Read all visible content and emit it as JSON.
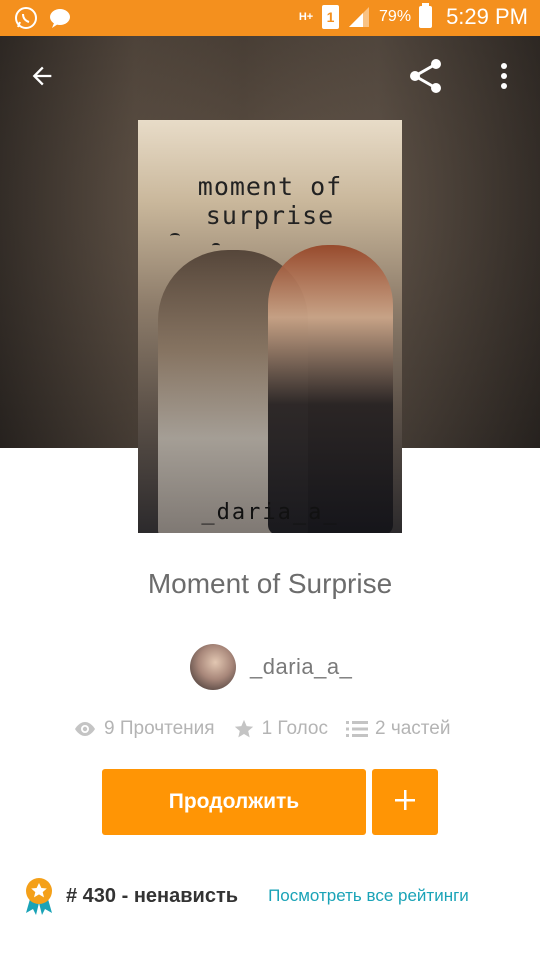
{
  "status_bar": {
    "battery_percent": "79%",
    "time": "5:29 PM",
    "network_type": "H+",
    "sim_slot": "1",
    "icons": [
      "whatsapp-icon",
      "message-icon",
      "signal-icon",
      "battery-icon"
    ]
  },
  "toolbar": {
    "icons": [
      "back-arrow-icon",
      "share-icon",
      "more-vert-icon"
    ]
  },
  "cover": {
    "title": "moment of surprise",
    "author": "_daria_a_"
  },
  "story": {
    "title": "Moment of Surprise",
    "author": "_daria_a_"
  },
  "stats": {
    "reads": "9 Прочтения",
    "votes": "1 Голос",
    "parts": "2 частей"
  },
  "actions": {
    "continue_label": "Продолжить",
    "add_label": "+"
  },
  "ranking": {
    "rank": "# 430",
    "separator": " - ",
    "tag": "ненависть",
    "view_all_label": "Посмотреть все рейтинги"
  },
  "colors": {
    "status_bar": "#f4901e",
    "accent": "#ff9505",
    "link": "#1aa3b7",
    "title_text": "#6c6c6c",
    "muted_text": "#b4b4b4"
  }
}
